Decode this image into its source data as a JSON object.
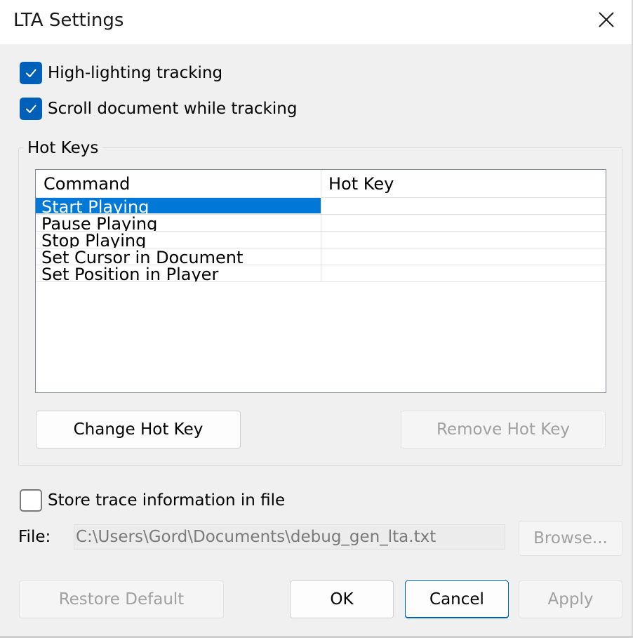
{
  "window": {
    "title": "LTA Settings"
  },
  "options": {
    "highlighting_label": "High-lighting tracking",
    "highlighting_checked": true,
    "scroll_label": "Scroll document while tracking",
    "scroll_checked": true
  },
  "hotkeys": {
    "group_label": "Hot Keys",
    "columns": [
      "Command",
      "Hot Key"
    ],
    "rows": [
      {
        "command": "Start Playing",
        "hotkey": "",
        "selected": true
      },
      {
        "command": "Pause Playing",
        "hotkey": "",
        "selected": false
      },
      {
        "command": "Stop Playing",
        "hotkey": "",
        "selected": false
      },
      {
        "command": "Set Cursor in Document",
        "hotkey": "",
        "selected": false
      },
      {
        "command": "Set Position in Player",
        "hotkey": "",
        "selected": false
      }
    ],
    "change_button": "Change Hot Key",
    "remove_button": "Remove Hot Key"
  },
  "trace": {
    "store_label": "Store trace information in file",
    "store_checked": false,
    "file_label": "File:",
    "file_value": "C:\\Users\\Gord\\Documents\\debug_gen_lta.txt",
    "browse_button": "Browse..."
  },
  "footer": {
    "restore_button": "Restore Default",
    "ok_button": "OK",
    "cancel_button": "Cancel",
    "apply_button": "Apply"
  },
  "colors": {
    "accent": "#005fb8",
    "selection": "#0078d7"
  }
}
